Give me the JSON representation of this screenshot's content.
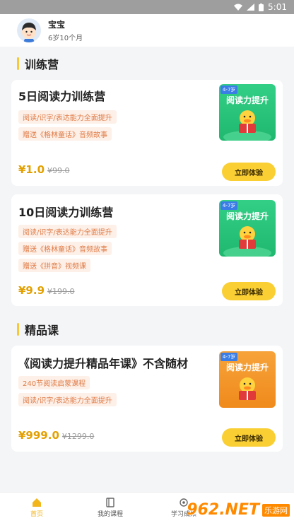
{
  "status_bar": {
    "time": "5:01"
  },
  "profile": {
    "name": "宝宝",
    "age": "6岁10个月"
  },
  "sections": {
    "camp_title": "训练营",
    "premium_title": "精品课"
  },
  "cards": [
    {
      "title": "5日阅读力训练营",
      "tags": [
        "阅读/识字/表达能力全面提升",
        "赠送《格林童话》音频故事"
      ],
      "price": "¥1.0",
      "old_price": "¥99.0",
      "button": "立即体验",
      "thumb_age": "4-7岁",
      "thumb_title": "阅读力提升"
    },
    {
      "title": "10日阅读力训练营",
      "tags": [
        "阅读/识字/表达能力全面提升",
        "赠送《格林童话》音频故事",
        "赠送《拼音》视频课"
      ],
      "price": "¥9.9",
      "old_price": "¥199.0",
      "button": "立即体验",
      "thumb_age": "4-7岁",
      "thumb_title": "阅读力提升"
    },
    {
      "title": "《阅读力提升精品年课》不含随材",
      "tags": [
        "240节阅读启蒙课程",
        "阅读/识字/表达能力全面提升"
      ],
      "price": "¥999.0",
      "old_price": "¥1299.0",
      "button": "立即体验",
      "thumb_age": "4-7岁",
      "thumb_title": "阅读力提升"
    }
  ],
  "tabbar": [
    {
      "label": "首页",
      "icon": "home-icon",
      "active": true
    },
    {
      "label": "我的课程",
      "icon": "book-icon",
      "active": false
    },
    {
      "label": "学习成果",
      "icon": "award-icon",
      "active": false
    }
  ],
  "watermark": {
    "logo": "962.NET",
    "sub": "乐游网"
  },
  "colors": {
    "accent": "#f9cf34",
    "price": "#e3a000",
    "tag": "#e07b46"
  }
}
